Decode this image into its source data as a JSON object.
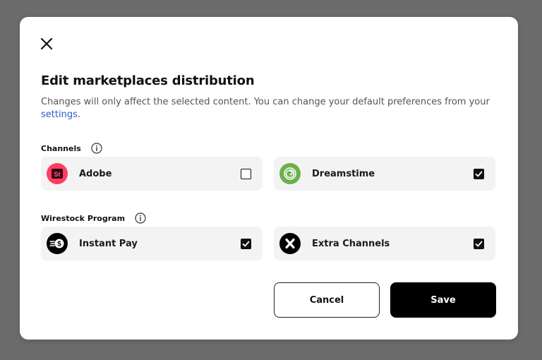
{
  "modal": {
    "title": "Edit marketplaces distribution",
    "subtitle_text": "Changes will only affect the selected content. You can change your default preferences from your ",
    "settings_link": "settings",
    "subtitle_end": "."
  },
  "channels": {
    "label": "Channels",
    "items": [
      {
        "label": "Adobe",
        "checked": false,
        "icon": "adobe-stock-icon",
        "color": "#ff3d63"
      },
      {
        "label": "Dreamstime",
        "checked": true,
        "icon": "dreamstime-spiral-icon",
        "color": "#6ab04c"
      }
    ]
  },
  "program": {
    "label": "Wirestock Program",
    "items": [
      {
        "label": "Instant Pay",
        "checked": true,
        "icon": "instant-pay-icon",
        "color": "#000000"
      },
      {
        "label": "Extra Channels",
        "checked": true,
        "icon": "extra-channels-x-icon",
        "color": "#000000"
      }
    ]
  },
  "buttons": {
    "cancel": "Cancel",
    "save": "Save"
  },
  "colors": {
    "backdrop": "#6b6b6b",
    "link": "#2d5ec9",
    "card_bg": "#f3f3f3"
  }
}
